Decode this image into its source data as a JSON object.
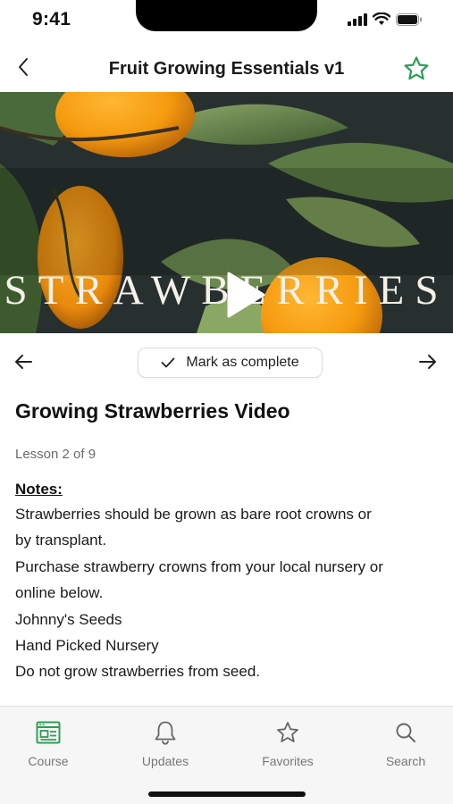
{
  "status": {
    "time": "9:41"
  },
  "header": {
    "title": "Fruit Growing Essentials v1"
  },
  "video": {
    "overlay_title": "STRAWBERRIES"
  },
  "lesson_nav": {
    "complete_label": "Mark as complete"
  },
  "lesson": {
    "title": "Growing Strawberries Video",
    "meta": "Lesson 2 of 9",
    "notes_heading": "Notes:",
    "notes": [
      "Strawberries should be grown as bare root crowns or",
      "by transplant.",
      "Purchase strawberry crowns from your local nursery or",
      "online below.",
      "Johnny's Seeds",
      "Hand Picked Nursery",
      "Do not grow strawberries from seed."
    ]
  },
  "tabs": [
    {
      "label": "Course",
      "icon": "course-icon"
    },
    {
      "label": "Updates",
      "icon": "bell-icon"
    },
    {
      "label": "Favorites",
      "icon": "star-icon"
    },
    {
      "label": "Search",
      "icon": "search-icon"
    }
  ],
  "colors": {
    "accent": "#2e9e57",
    "tab_label": "#777777"
  }
}
